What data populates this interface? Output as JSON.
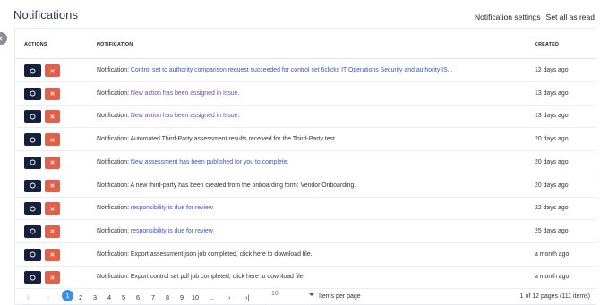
{
  "header": {
    "title": "Notifications",
    "settings_link": "Notification settings",
    "set_all_read_link": "Set all as read"
  },
  "table": {
    "columns": {
      "actions": "ACTIONS",
      "notification": "NOTIFICATION",
      "created": "CREATED"
    },
    "rows": [
      {
        "prefix": "Notification: ",
        "message": "Control set to authority comparison request succeeded for control set 6clicks IT Operations Security and authority IS...",
        "style": "link",
        "created": "12 days ago"
      },
      {
        "prefix": "Notification: ",
        "message": "New action has been assigned in Issue.",
        "style": "visited",
        "created": "13 days ago"
      },
      {
        "prefix": "Notification: ",
        "message": "New action has been assigned in Issue.",
        "style": "visited",
        "created": "13 days ago"
      },
      {
        "prefix": "Notification: ",
        "message": "Automated Third-Party assessment results received for the Third-Party test",
        "style": "plain",
        "created": "20 days ago"
      },
      {
        "prefix": "Notification: ",
        "message": "New assessment has been published for you to complete.",
        "style": "link",
        "created": "20 days ago"
      },
      {
        "prefix": "Notification: ",
        "message": "A new third-party has been created from the onboarding form: Vendor Onboarding.",
        "style": "plain",
        "created": "20 days ago"
      },
      {
        "prefix": "Notification: ",
        "message": "responsibility is due for review",
        "style": "link",
        "created": "22 days ago"
      },
      {
        "prefix": "Notification: ",
        "message": "responsibility is due for review",
        "style": "link",
        "created": "25 days ago"
      },
      {
        "prefix": "Notification: ",
        "message": "Export assessment json job completed, click here to download file.",
        "style": "plain",
        "created": "a month ago"
      },
      {
        "prefix": "Notification: ",
        "message": "Export control set pdf job completed, click here to download file.",
        "style": "plain",
        "created": "a month ago"
      }
    ]
  },
  "pagination": {
    "first": "|‹",
    "prev": "‹",
    "pages": [
      "1",
      "2",
      "3",
      "4",
      "5",
      "6",
      "7",
      "8",
      "9",
      "10"
    ],
    "active_page": "1",
    "ellipsis": "...",
    "next": "›",
    "last": "›|",
    "per_page_value": "10",
    "per_page_label": "Items per page",
    "info": "1 of 12 pages (111 items)"
  },
  "colors": {
    "open_button": "#14213d",
    "dismiss_button": "#e0604a",
    "link": "#3b54c9",
    "visited_link": "#6b4fa3",
    "active_page": "#3f8fe0"
  },
  "icons": {
    "open": "circle-icon",
    "dismiss": "close-icon",
    "collapse": "chevron-left-icon"
  }
}
